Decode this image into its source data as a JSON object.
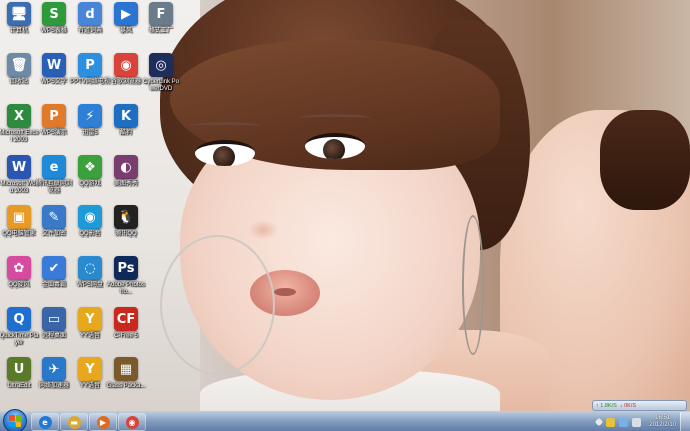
{
  "desktop": {
    "icons": [
      {
        "label": "计算机",
        "glyph": "🖥",
        "color": "#3b6db3"
      },
      {
        "label": "WPS表格",
        "glyph": "S",
        "color": "#2e9a3c"
      },
      {
        "label": "有道词典",
        "glyph": "d",
        "color": "#4a86d8"
      },
      {
        "label": "暴风",
        "glyph": "▶",
        "color": "#2b74d1"
      },
      {
        "label": "格式工厂",
        "glyph": "F",
        "color": "#6a7b8c"
      },
      {
        "label": "回收站",
        "glyph": "🗑",
        "color": "#6e8aa6"
      },
      {
        "label": "WPS文字",
        "glyph": "W",
        "color": "#2a5fb6"
      },
      {
        "label": "PPTV网络电视",
        "glyph": "P",
        "color": "#2d8fe0"
      },
      {
        "label": "谷歌浏览器",
        "glyph": "◉",
        "color": "#d9443a"
      },
      {
        "label": "CyberLink PowerDVD",
        "glyph": "◎",
        "color": "#1f2d5c"
      },
      {
        "label": "Microsoft Excel 2003",
        "glyph": "X",
        "color": "#2d8a3e"
      },
      {
        "label": "WPS演示",
        "glyph": "P",
        "color": "#e0792a"
      },
      {
        "label": "迅雷5",
        "glyph": "⚡",
        "color": "#2f7fd6"
      },
      {
        "label": "酷狗",
        "glyph": "K",
        "color": "#1e6fc4"
      },
      {
        "label": "Microsoft Word 2003",
        "glyph": "W",
        "color": "#2a55b0"
      },
      {
        "label": "腾讯互联网浏览器",
        "glyph": "e",
        "color": "#1e8ad8"
      },
      {
        "label": "QQ游戏",
        "glyph": "❖",
        "color": "#3ca03c"
      },
      {
        "label": "美图秀秀",
        "glyph": "◐",
        "color": "#7a3e6e"
      },
      {
        "label": "QQ电脑管家",
        "glyph": "▣",
        "color": "#e89a26"
      },
      {
        "label": "文件加密",
        "glyph": "✎",
        "color": "#3a78c8"
      },
      {
        "label": "QQ影音",
        "glyph": "◉",
        "color": "#1e9ad8"
      },
      {
        "label": "腾讯QQ",
        "glyph": "🐧",
        "color": "#222222"
      },
      {
        "label": "QQ旋风",
        "glyph": "✿",
        "color": "#d64aa0"
      },
      {
        "label": "金山毒霸",
        "glyph": "✔",
        "color": "#3a7ad8"
      },
      {
        "label": "WPS网盘",
        "glyph": "◌",
        "color": "#2a8ad0"
      },
      {
        "label": "Adobe Photosho...",
        "glyph": "Ps",
        "color": "#0f2a5a"
      },
      {
        "label": "QuickTime Player",
        "glyph": "Q",
        "color": "#1f6fd0"
      },
      {
        "label": "远程桌面",
        "glyph": "▭",
        "color": "#3a66a8"
      },
      {
        "label": "YY语音",
        "glyph": "Y",
        "color": "#e8a81e"
      },
      {
        "label": "C-Free 5",
        "glyph": "CF",
        "color": "#c8281e"
      },
      {
        "label": "UltraEdit",
        "glyph": "U",
        "color": "#5a7a2a"
      },
      {
        "label": "网络加速器",
        "glyph": "✈",
        "color": "#2a78c8"
      },
      {
        "label": "YY语音",
        "glyph": "Y",
        "color": "#e8a81e"
      },
      {
        "label": "Glass Packa...",
        "glyph": "▦",
        "color": "#7a5a2a"
      }
    ]
  },
  "taskbar": {
    "apps": [
      {
        "name": "ie",
        "glyph": "e",
        "color": "#1e7ad8"
      },
      {
        "name": "explorer",
        "glyph": "▬",
        "color": "#d8a838"
      },
      {
        "name": "media-player",
        "glyph": "▶",
        "color": "#e06a1e"
      },
      {
        "name": "chrome",
        "glyph": "◉",
        "color": "#d9443a"
      }
    ],
    "clock_time": "16:51",
    "clock_date": "2012/2/10"
  },
  "net_widget": {
    "up": "↑ 1.8K/S",
    "down": "↓ 0K/S"
  },
  "colors": {
    "taskbar": "#7896be",
    "start_orb": "#2f7fd6"
  }
}
